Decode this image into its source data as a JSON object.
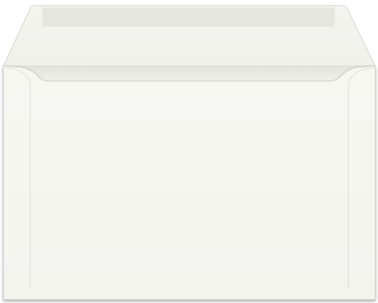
{
  "scene": {
    "subject": "open-envelope",
    "colors": {
      "background": "#ffffff",
      "paper": "#f6f6f1",
      "flap": "#f3f3ee",
      "flap_band": "#e6e6e1",
      "interior": "#ecece8",
      "edge": "#d4d4cf",
      "shadow": "#bdbdb8"
    }
  }
}
